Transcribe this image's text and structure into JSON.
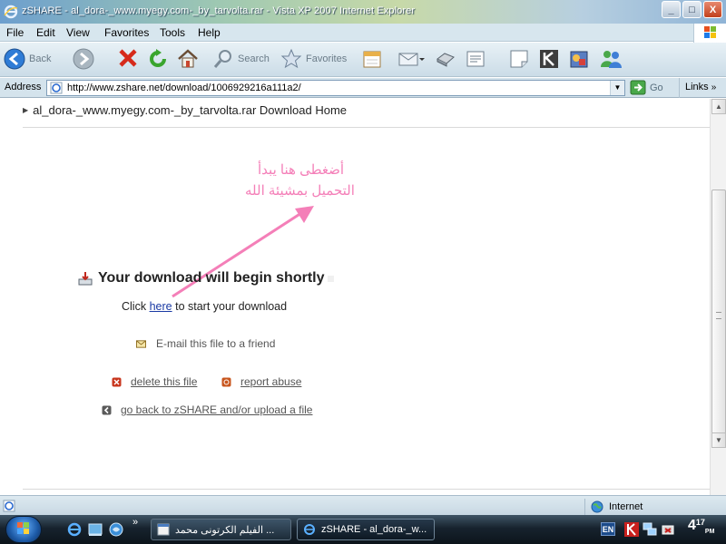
{
  "window": {
    "title": "zSHARE - al_dora-_www.myegy.com-_by_tarvolta.rar - Vista XP 2007 Internet Explorer",
    "minimize_label": "_",
    "maximize_label": "□",
    "close_label": "X"
  },
  "menu": {
    "items": [
      {
        "label": "File"
      },
      {
        "label": "Edit"
      },
      {
        "label": "View"
      },
      {
        "label": "Favorites"
      },
      {
        "label": "Tools"
      },
      {
        "label": "Help"
      }
    ]
  },
  "toolbar": {
    "back_label": "Back",
    "search_label": "Search",
    "favorites_label": "Favorites"
  },
  "address": {
    "label": "Address",
    "url": "http://www.zshare.net/download/1006929216a111a2/",
    "go_label": "Go",
    "links_label": "Links"
  },
  "content": {
    "breadcrumb": "al_dora-_www.myegy.com-_by_tarvolta.rar Download Home",
    "annotation_line1": "أضغطى هنا يبدأ",
    "annotation_line2": "التحميل بمشيئة الله",
    "heading": "Your download will begin shortly",
    "click_prefix": "Click",
    "click_link": "here",
    "click_suffix": "to start your download",
    "email_label": "E-mail this file to a friend",
    "delete_label": "delete this file",
    "report_label": "report abuse",
    "back_label": "go back to zSHARE and/or upload a file"
  },
  "status": {
    "zone": "Internet"
  },
  "taskbar": {
    "task1": "الفيلم الكرتونى محمد ...",
    "task2": "zSHARE - al_dora-_w...",
    "language": "EN",
    "clock_hour": "4",
    "clock_min": "17",
    "clock_ampm": "PM"
  },
  "colors": {
    "annotation": "#f47fb8",
    "link": "#1a3aa4"
  }
}
